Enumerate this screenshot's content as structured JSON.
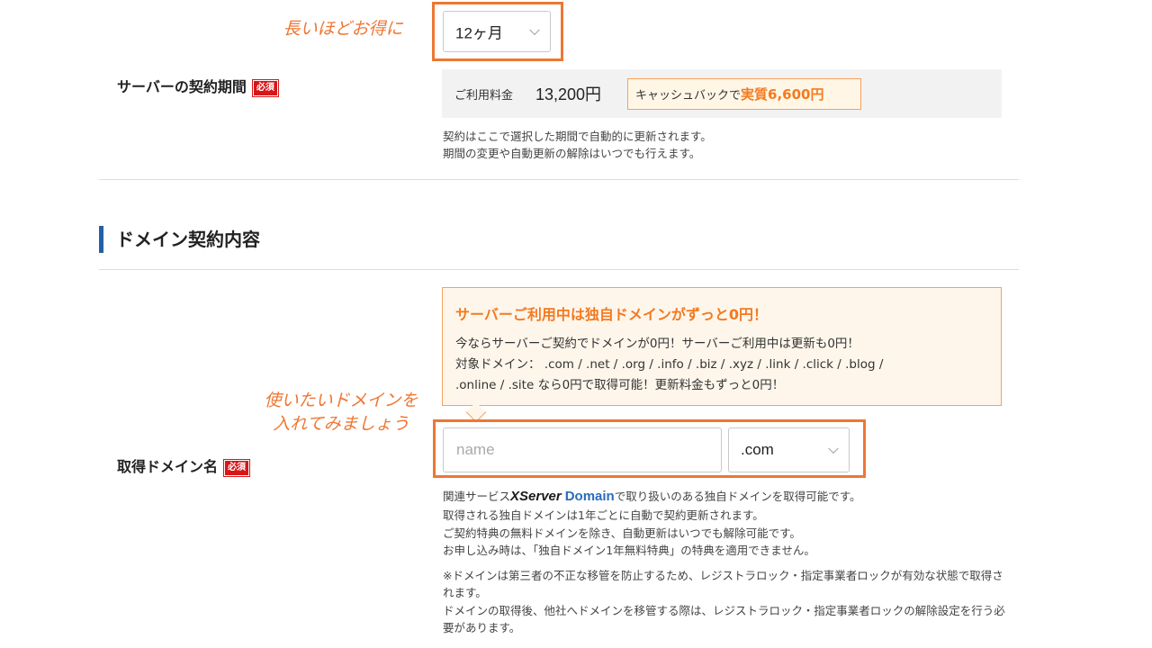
{
  "annotations": {
    "period_hint": "長いほどお得に",
    "domain_hint_line1": "使いたいドメインを",
    "domain_hint_line2": "入れてみましょう"
  },
  "server_period": {
    "label": "サーバーの契約期間",
    "required_badge": "必須",
    "selected": "12ヶ月",
    "fee_label": "ご利用料金",
    "fee_amount": "13,200円",
    "cashback_prefix": "キャッシュバックで",
    "cashback_highlight": "実質6,600円",
    "note_line1": "契約はここで選択した期間で自動的に更新されます。",
    "note_line2": "期間の変更や自動更新の解除はいつでも行えます。"
  },
  "domain_section": {
    "title": "ドメイン契約内容"
  },
  "promo": {
    "title": "サーバーご利用中は独自ドメインがずっと0円！",
    "line1": "今ならサーバーご契約でドメインが0円！サーバーご利用中は更新も0円！",
    "line2": "対象ドメイン： .com / .net / .org / .info / .biz / .xyz / .link / .click / .blog /",
    "line3": ".online / .site なら0円で取得可能！更新料金もずっと0円！"
  },
  "domain_field": {
    "label": "取得ドメイン名",
    "required_badge": "必須",
    "placeholder": "name",
    "tld_selected": ".com"
  },
  "domain_notes": {
    "line1_prefix": "関連サービス",
    "brand_x": "XServer",
    "brand_domain": "Domain",
    "line1_suffix": "で取り扱いのある独自ドメインを取得可能です。",
    "line2": "取得される独自ドメインは1年ごとに自動で契約更新されます。",
    "line3": "ご契約特典の無料ドメインを除き、自動更新はいつでも解除可能です。",
    "line4": "お申し込み時は、「独自ドメイン1年無料特典」の特典を適用できません。",
    "warn1": "※ドメインは第三者の不正な移管を防止するため、レジストラロック・指定事業者ロックが有効な状態で取得されます。",
    "warn2": "ドメインの取得後、他社へドメインを移管する際は、レジストラロック・指定事業者ロックの解除設定を行う必要があります。"
  },
  "colors": {
    "accent_orange": "#ee7733",
    "required_red": "#d71618",
    "section_bar_blue": "#2360a6",
    "brand_blue": "#2b6bbd"
  }
}
